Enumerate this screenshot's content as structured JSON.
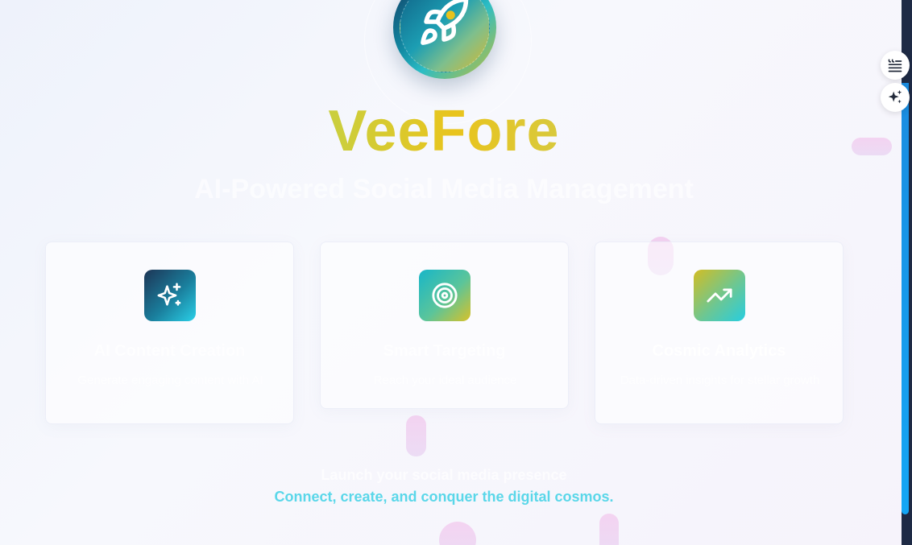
{
  "brand": {
    "name": "VeeFore",
    "tagline": "AI-Powered Social Media Management"
  },
  "features": [
    {
      "title": "AI Content Creation",
      "description": "Generate engaging content with AI",
      "icon": "sparkles-icon"
    },
    {
      "title": "Smart Targeting",
      "description": "Reach your ideal audience",
      "icon": "target-icon"
    },
    {
      "title": "Cosmic Analytics",
      "description": "Data-driven insights for stellar growth",
      "icon": "trending-up-icon"
    }
  ],
  "footer": {
    "line1": "Launch your social media presence",
    "line2": "Connect, create, and conquer the digital cosmos."
  },
  "side_tools": [
    {
      "icon": "quote-list-icon"
    },
    {
      "icon": "sparkle-icon"
    }
  ],
  "colors": {
    "brand_gradient_start": "#c9cf3f",
    "brand_gradient_mid": "#e9c41d",
    "footer_accent": "#5ad7e9",
    "scroll_accent": "#1a8ce0"
  }
}
